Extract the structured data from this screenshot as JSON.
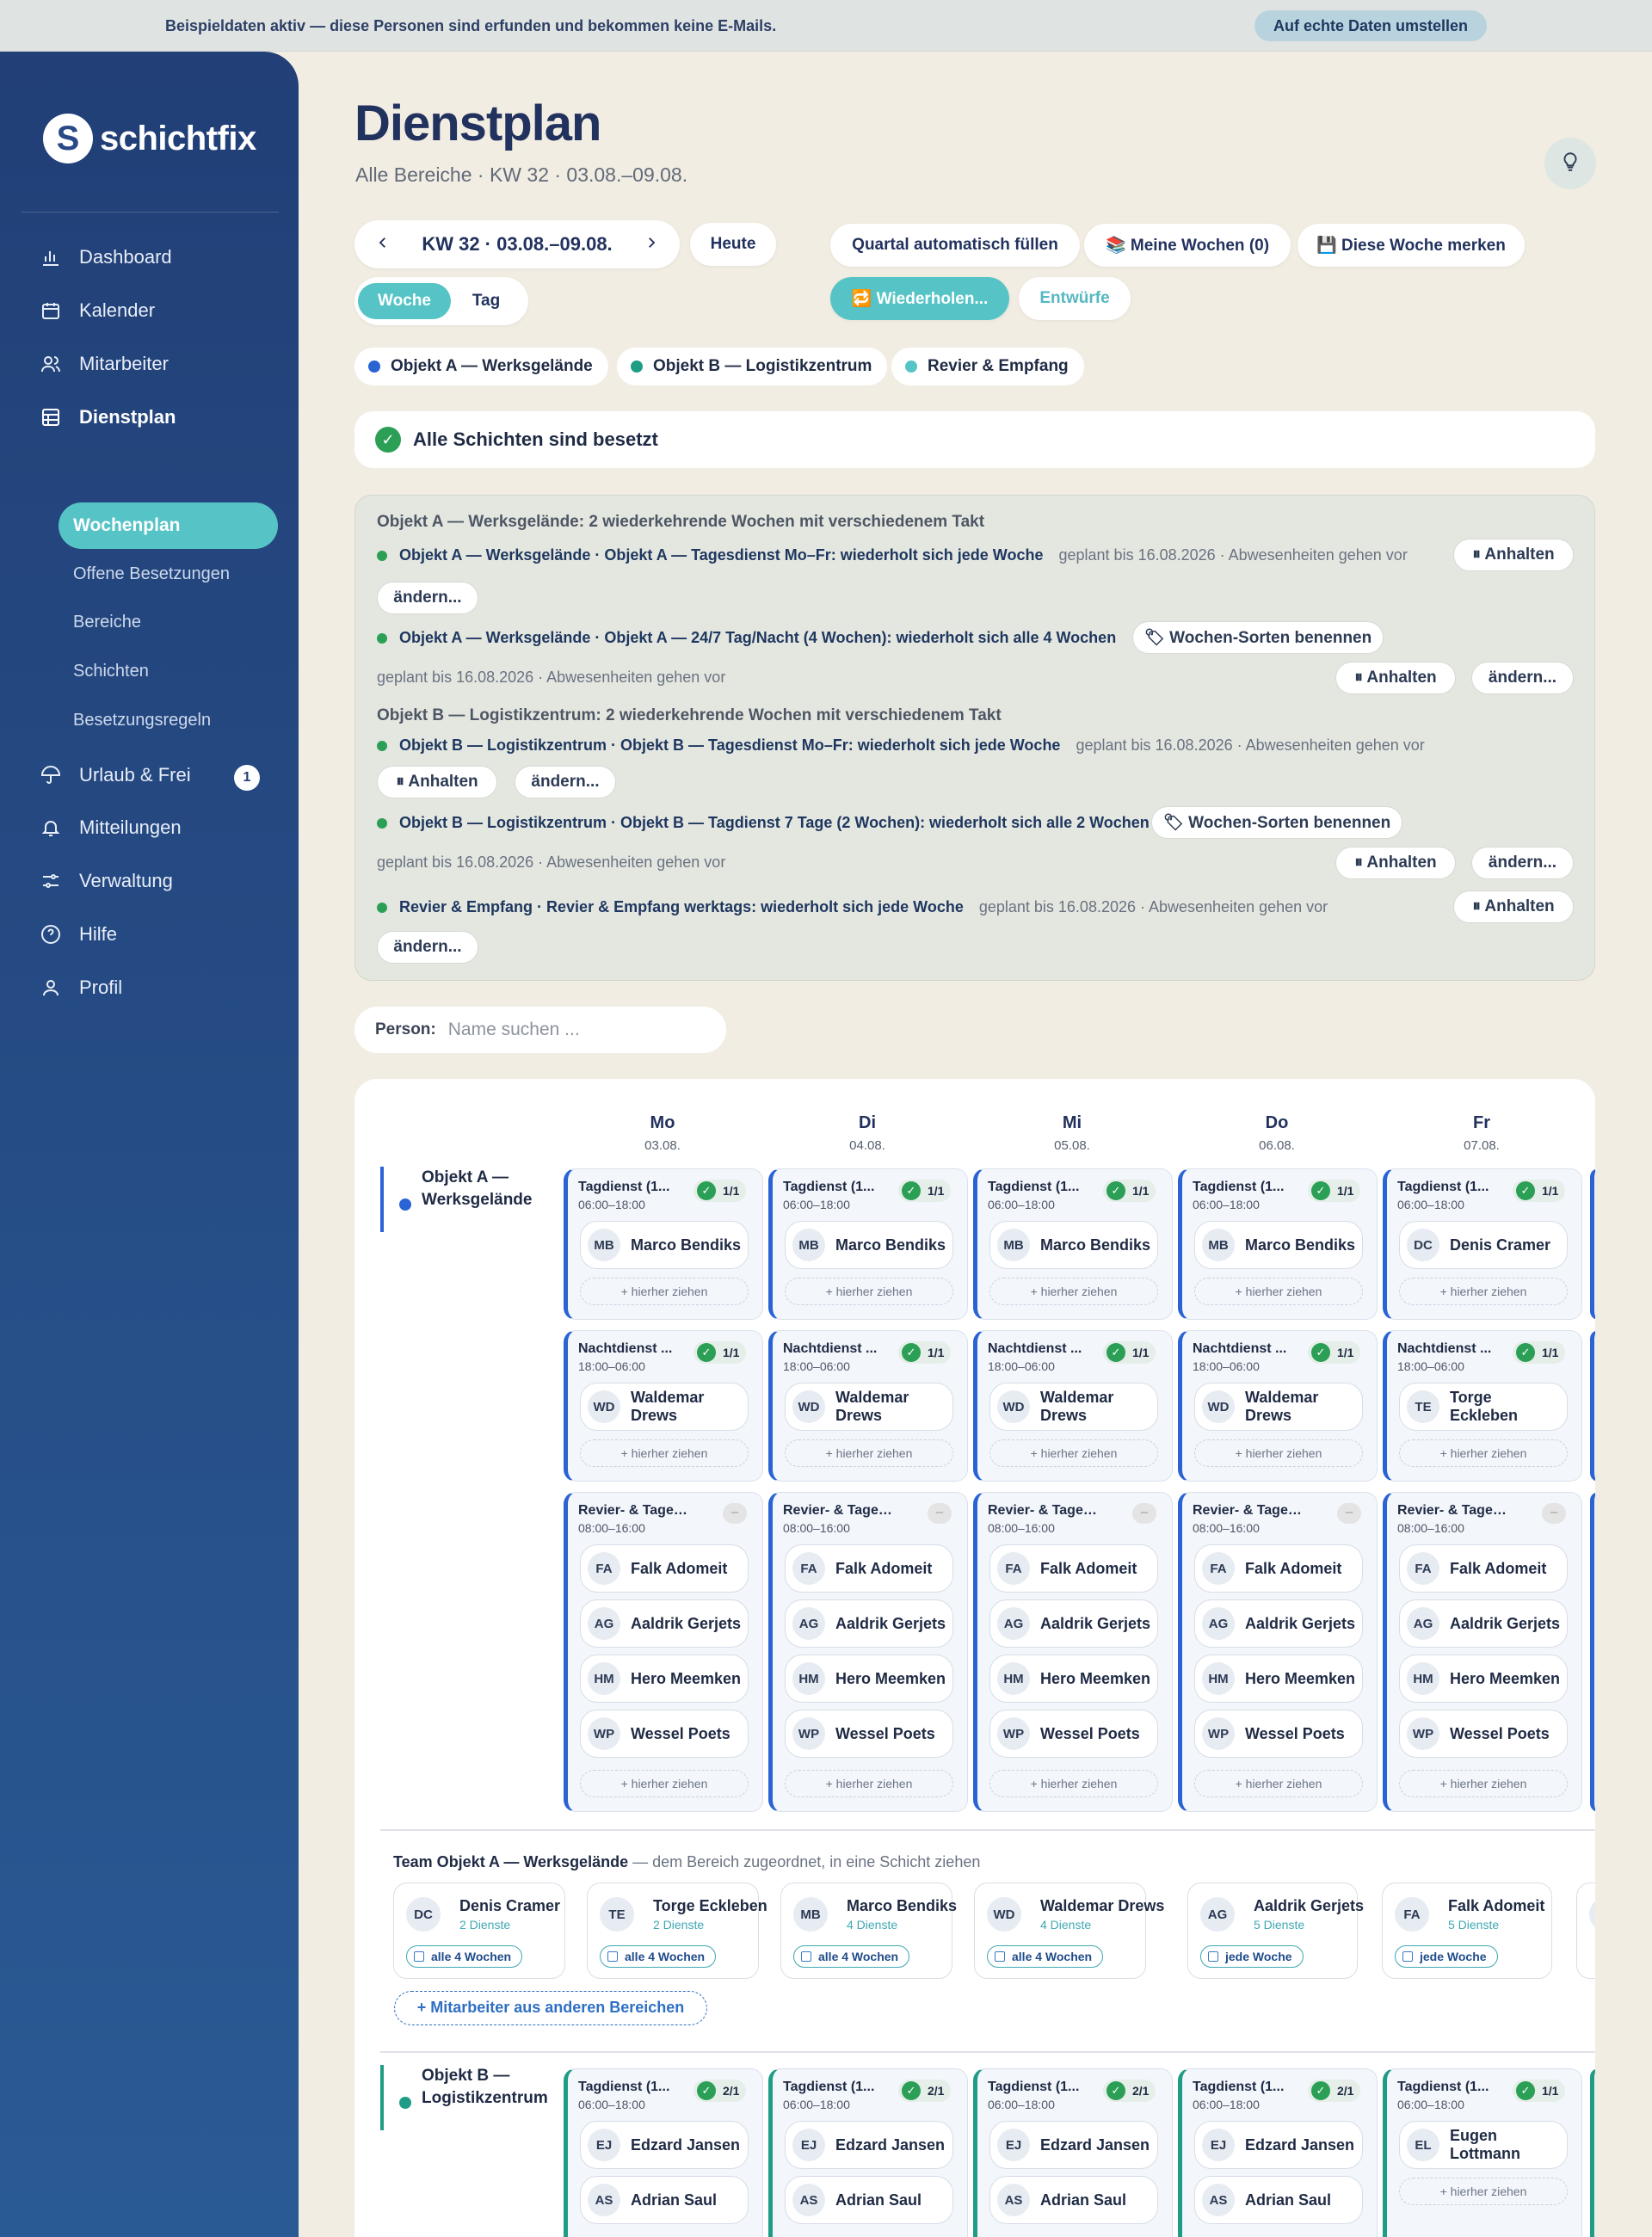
{
  "banner": {
    "text": "Beispieldaten aktiv — diese Personen sind erfunden und bekommen keine E-Mails.",
    "button": "Auf echte Daten umstellen"
  },
  "app": {
    "name": "schichtfix",
    "logo_letter": "S"
  },
  "nav": [
    {
      "label": "Dashboard",
      "icon": "bar-chart-icon"
    },
    {
      "label": "Kalender",
      "icon": "calendar-icon"
    },
    {
      "label": "Mitarbeiter",
      "icon": "users-icon"
    },
    {
      "label": "Dienstplan",
      "icon": "grid-icon"
    },
    {
      "label": "Urlaub & Frei",
      "icon": "umbrella-icon"
    },
    {
      "label": "Mitteilungen",
      "icon": "bell-icon"
    },
    {
      "label": "Verwaltung",
      "icon": "sliders-icon"
    },
    {
      "label": "Hilfe",
      "icon": "help-icon"
    },
    {
      "label": "Profil",
      "icon": "user-icon"
    }
  ],
  "subnav": [
    "Wochenplan",
    "Offene Besetzungen",
    "Bereiche",
    "Schichten",
    "Besetzungsregeln"
  ],
  "urlaub_badge": "1",
  "header": {
    "title": "Dienstplan",
    "subtitle": "Alle Bereiche · KW 32 · 03.08.–09.08."
  },
  "toolbar": {
    "week": "KW 32 · 03.08.–09.08.",
    "today": "Heute",
    "view_week": "Woche",
    "view_day": "Tag",
    "fill_quarter": "Quartal automatisch füllen",
    "my_weeks": "📚 Meine Wochen (0)",
    "remember_week": "💾 Diese Woche merken",
    "repeat": "🔁 Wiederholen...",
    "drafts": "Entwürfe"
  },
  "areas": [
    {
      "name": "Objekt A — Werksgelände",
      "color": "#2a63d4"
    },
    {
      "name": "Objekt B — Logistikzentrum",
      "color": "#1f9c86"
    },
    {
      "name": "Revier & Empfang",
      "color": "#56c4c6"
    }
  ],
  "status": "Alle Schichten sind besetzt",
  "recurring": {
    "heading_a": "Objekt A — Werksgelände: 2 wiederkehrende Wochen mit verschiedenem Takt",
    "heading_b": "Objekt B — Logistikzentrum: 2 wiederkehrende Wochen mit verschiedenem Takt",
    "planned": "geplant bis 16.08.2026 · Abwesenheiten gehen vor",
    "pause": "⏸ Anhalten",
    "change": "ändern...",
    "name_sorts": "🏷 Wochen-Sorten benennen",
    "lines": [
      "Objekt A — Werksgelände · Objekt A — Tagesdienst Mo–Fr: wiederholt sich jede Woche",
      "Objekt A — Werksgelände · Objekt A — 24/7 Tag/Nacht (4 Wochen): wiederholt sich alle 4 Wochen",
      "Objekt B — Logistikzentrum · Objekt B — Tagesdienst Mo–Fr: wiederholt sich jede Woche",
      "Objekt B — Logistikzentrum · Objekt B — Tagdienst 7 Tage (2 Wochen): wiederholt sich alle 2 Wochen",
      "Revier & Empfang · Revier & Empfang werktags: wiederholt sich jede Woche"
    ]
  },
  "search": {
    "label": "Person:",
    "placeholder": "Name suchen ..."
  },
  "days": [
    {
      "name": "Mo",
      "date": "03.08."
    },
    {
      "name": "Di",
      "date": "04.08."
    },
    {
      "name": "Mi",
      "date": "05.08."
    },
    {
      "name": "Do",
      "date": "06.08."
    },
    {
      "name": "Fr",
      "date": "07.08."
    }
  ],
  "drop_hint": "+ hierher ziehen",
  "board": {
    "area_a": "Objekt A — Werksgelände",
    "area_b": "Objekt B — Logistikzentrum",
    "shifts": {
      "tag_a": {
        "title": "Tagdienst (1...",
        "time": "06:00–18:00",
        "count": "1/1"
      },
      "nacht_a": {
        "title": "Nachtdienst ...",
        "time": "18:00–06:00",
        "count": "1/1"
      },
      "revier": {
        "title": "Revier- & Tagesd...",
        "time": "08:00–16:00",
        "count": "–"
      },
      "tag_b": {
        "title": "Tagdienst (1...",
        "time": "06:00–18:00"
      }
    },
    "tag_a_people": [
      {
        "ini": "MB",
        "name": "Marco Bendiks"
      },
      {
        "ini": "MB",
        "name": "Marco Bendiks"
      },
      {
        "ini": "MB",
        "name": "Marco Bendiks"
      },
      {
        "ini": "MB",
        "name": "Marco Bendiks"
      },
      {
        "ini": "DC",
        "name": "Denis Cramer"
      }
    ],
    "nacht_a_people": [
      {
        "ini": "WD",
        "name": "Waldemar Drews"
      },
      {
        "ini": "WD",
        "name": "Waldemar Drews"
      },
      {
        "ini": "WD",
        "name": "Waldemar Drews"
      },
      {
        "ini": "WD",
        "name": "Waldemar Drews"
      },
      {
        "ini": "TE",
        "name": "Torge Eckleben"
      }
    ],
    "revier_people": [
      {
        "ini": "FA",
        "name": "Falk Adomeit"
      },
      {
        "ini": "AG",
        "name": "Aaldrik Gerjets"
      },
      {
        "ini": "HM",
        "name": "Hero Meemken"
      },
      {
        "ini": "WP",
        "name": "Wessel Poets"
      }
    ],
    "tag_b_days": [
      {
        "count": "2/1",
        "people": [
          {
            "ini": "EJ",
            "name": "Edzard Jansen"
          },
          {
            "ini": "AS",
            "name": "Adrian Saul"
          }
        ]
      },
      {
        "count": "2/1",
        "people": [
          {
            "ini": "EJ",
            "name": "Edzard Jansen"
          },
          {
            "ini": "AS",
            "name": "Adrian Saul"
          }
        ]
      },
      {
        "count": "2/1",
        "people": [
          {
            "ini": "EJ",
            "name": "Edzard Jansen"
          },
          {
            "ini": "AS",
            "name": "Adrian Saul"
          }
        ]
      },
      {
        "count": "2/1",
        "people": [
          {
            "ini": "EJ",
            "name": "Edzard Jansen"
          },
          {
            "ini": "AS",
            "name": "Adrian Saul"
          }
        ]
      },
      {
        "count": "1/1",
        "people": [
          {
            "ini": "EL",
            "name": "Eugen Lottmann"
          }
        ]
      }
    ]
  },
  "team": {
    "title": "Team Objekt A — Werksgelände",
    "subtitle": "— dem Bereich zugeordnet, in eine Schicht ziehen",
    "members": [
      {
        "ini": "DC",
        "name": "Denis Cramer",
        "duties": "2 Dienste",
        "rhythm": "alle 4 Wochen"
      },
      {
        "ini": "TE",
        "name": "Torge Eckleben",
        "duties": "2 Dienste",
        "rhythm": "alle 4 Wochen"
      },
      {
        "ini": "MB",
        "name": "Marco Bendiks",
        "duties": "4 Dienste",
        "rhythm": "alle 4 Wochen"
      },
      {
        "ini": "WD",
        "name": "Waldemar Drews",
        "duties": "4 Dienste",
        "rhythm": "alle 4 Wochen"
      },
      {
        "ini": "AG",
        "name": "Aaldrik Gerjets",
        "duties": "5 Dienste",
        "rhythm": "jede Woche"
      },
      {
        "ini": "FA",
        "name": "Falk Adomeit",
        "duties": "5 Dienste",
        "rhythm": "jede Woche"
      },
      {
        "ini": "H",
        "name": "",
        "duties": "",
        "rhythm": ""
      }
    ],
    "add_other": "+ Mitarbeiter aus anderen Bereichen"
  }
}
